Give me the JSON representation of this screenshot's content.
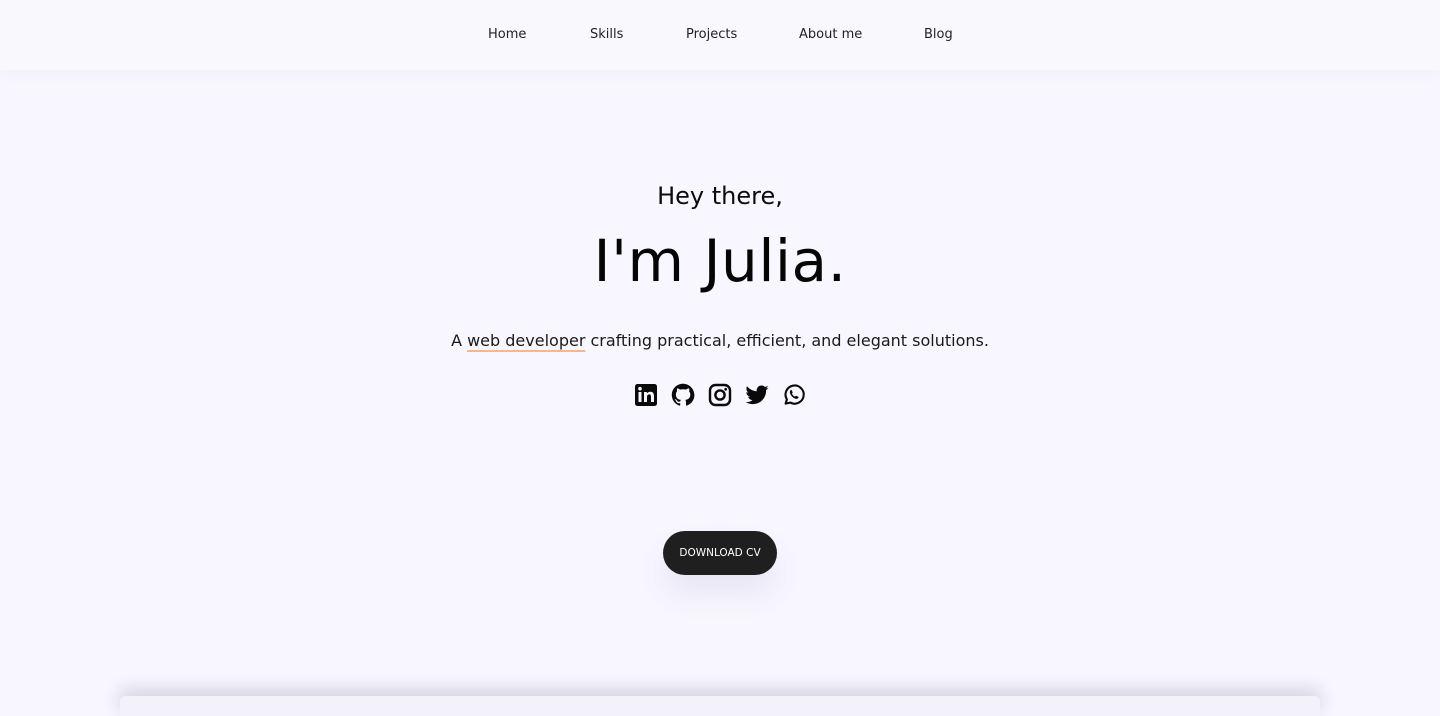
{
  "nav": {
    "items": [
      {
        "label": "Home"
      },
      {
        "label": "Skills"
      },
      {
        "label": "Projects"
      },
      {
        "label": "About me"
      },
      {
        "label": "Blog"
      }
    ]
  },
  "hero": {
    "greeting": "Hey there,",
    "name": "I'm Julia.",
    "tagline_prefix": "A ",
    "tagline_highlight": "web developer",
    "tagline_suffix": " crafting practical, efficient, and elegant solutions.",
    "highlight_color": "#f4b88c"
  },
  "socials": [
    "linkedin-icon",
    "github-icon",
    "instagram-icon",
    "twitter-icon",
    "whatsapp-icon"
  ],
  "cta": {
    "label": "DOWNLOAD CV",
    "color": "#1f1f1f"
  },
  "colors": {
    "background": "#f8f6ff",
    "text": "#111111"
  }
}
